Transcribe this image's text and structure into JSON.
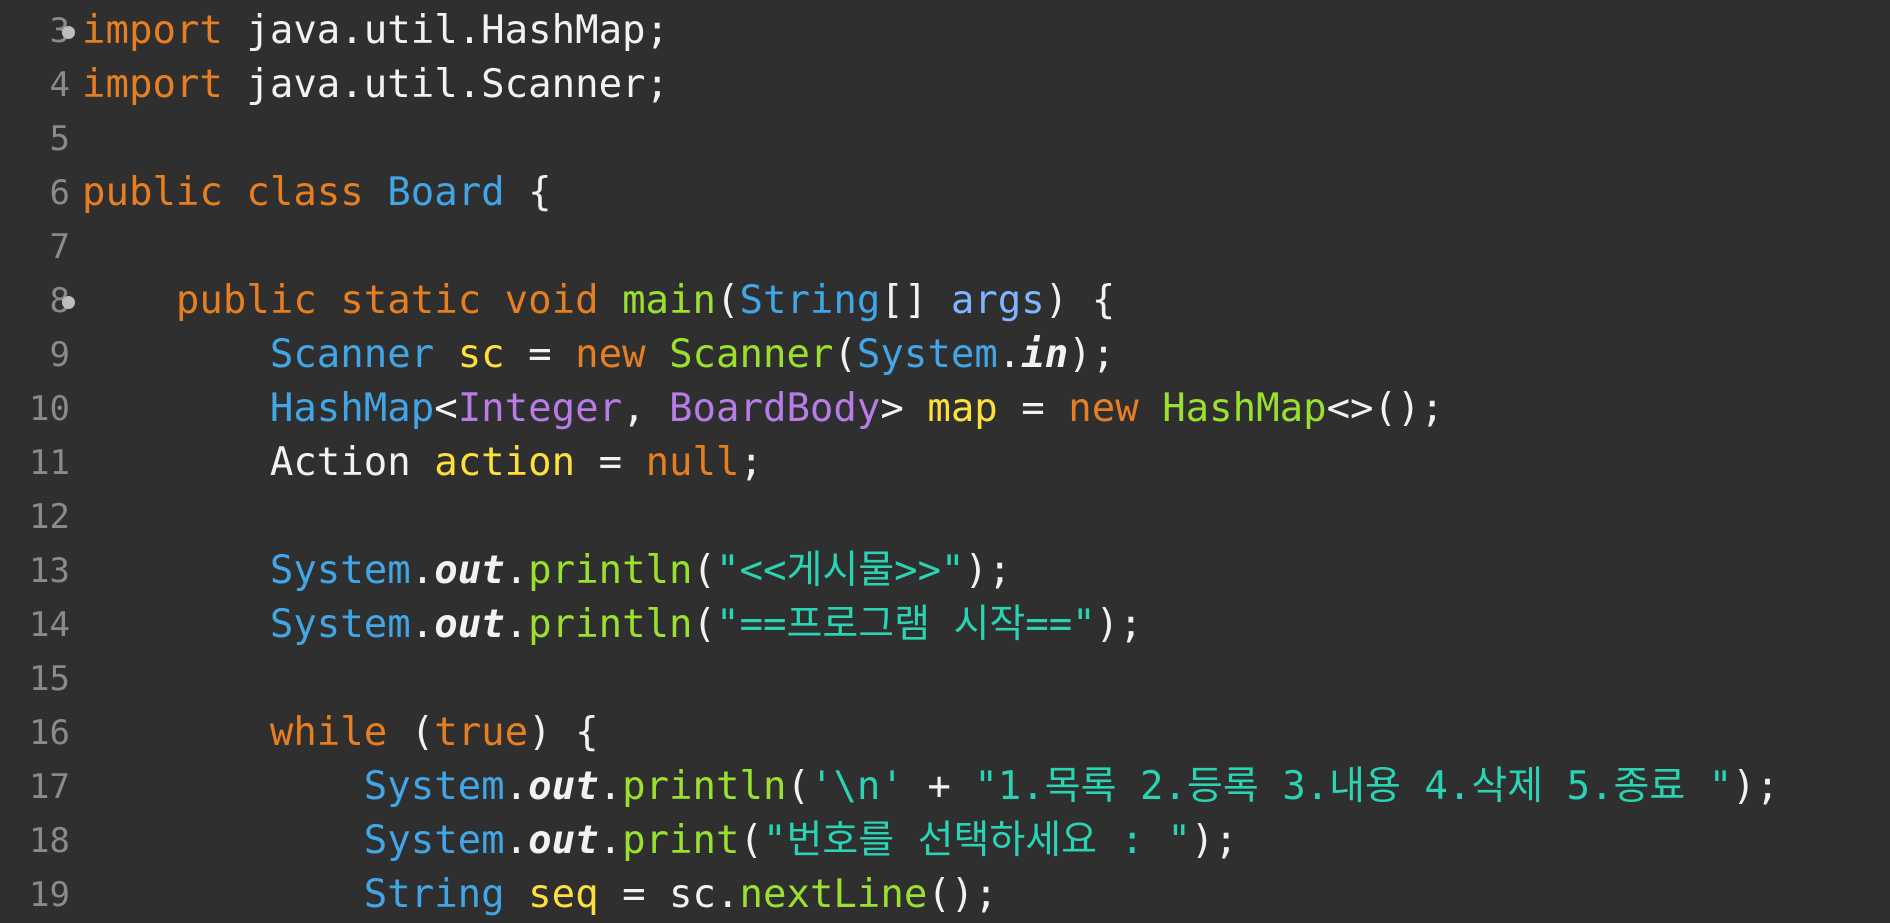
{
  "gutter": {
    "line_numbers": [
      "3",
      "4",
      "5",
      "6",
      "7",
      "8",
      "9",
      "10",
      "11",
      "12",
      "13",
      "14",
      "15",
      "16",
      "17",
      "18",
      "19"
    ]
  },
  "code": {
    "l3": {
      "kw": "import",
      "rest": " java.util.HashMap;"
    },
    "l4": {
      "kw": "import",
      "rest": " java.util.Scanner;"
    },
    "l6": {
      "kw1": "public",
      "kw2": "class",
      "name": "Board",
      "brace": " {"
    },
    "l8": {
      "indent": "    ",
      "kw1": "public",
      "kw2": "static",
      "kw3": "void",
      "method": "main",
      "open": "(",
      "type": "String",
      "arr": "[] ",
      "param": "args",
      "close": ") {"
    },
    "l9": {
      "indent": "        ",
      "type": "Scanner",
      "sp": " ",
      "var": "sc",
      "eq": " = ",
      "kw": "new",
      "sp2": " ",
      "ctor": "Scanner",
      "open": "(",
      "sys": "System",
      "dot": ".",
      "field": "in",
      "end": ");"
    },
    "l10": {
      "indent": "        ",
      "type": "HashMap",
      "lt": "<",
      "t1": "Integer",
      "comma": ", ",
      "t2": "BoardBody",
      "gt": "> ",
      "var": "map",
      "eq": " = ",
      "kw": "new",
      "sp": " ",
      "ctor": "HashMap",
      "end": "<>();"
    },
    "l11": {
      "indent": "        ",
      "type": "Action",
      "sp": " ",
      "var": "action",
      "eq": " = ",
      "kw": "null",
      "end": ";"
    },
    "l13": {
      "indent": "        ",
      "sys": "System",
      "dot": ".",
      "field": "out",
      "dot2": ".",
      "method": "println",
      "open": "(",
      "str": "\"<<게시물>>\"",
      "end": ");"
    },
    "l14": {
      "indent": "        ",
      "sys": "System",
      "dot": ".",
      "field": "out",
      "dot2": ".",
      "method": "println",
      "open": "(",
      "str": "\"==프로그램 시작==\"",
      "end": ");"
    },
    "l16": {
      "indent": "        ",
      "kw": "while",
      "open": " (",
      "kw2": "true",
      "close": ") {"
    },
    "l17": {
      "indent": "            ",
      "sys": "System",
      "dot": ".",
      "field": "out",
      "dot2": ".",
      "method": "println",
      "open": "(",
      "chr": "'\\n'",
      "plus": " + ",
      "str": "\"1.목록 2.등록 3.내용 4.삭제 5.종료 \"",
      "end": ");"
    },
    "l18": {
      "indent": "            ",
      "sys": "System",
      "dot": ".",
      "field": "out",
      "dot2": ".",
      "method": "print",
      "open": "(",
      "str": "\"번호를 선택하세요 : \"",
      "end": ");"
    },
    "l19": {
      "indent": "            ",
      "type": "String",
      "sp": " ",
      "var": "seq",
      "eq": " = sc.",
      "method": "nextLine",
      "end": "();"
    }
  }
}
